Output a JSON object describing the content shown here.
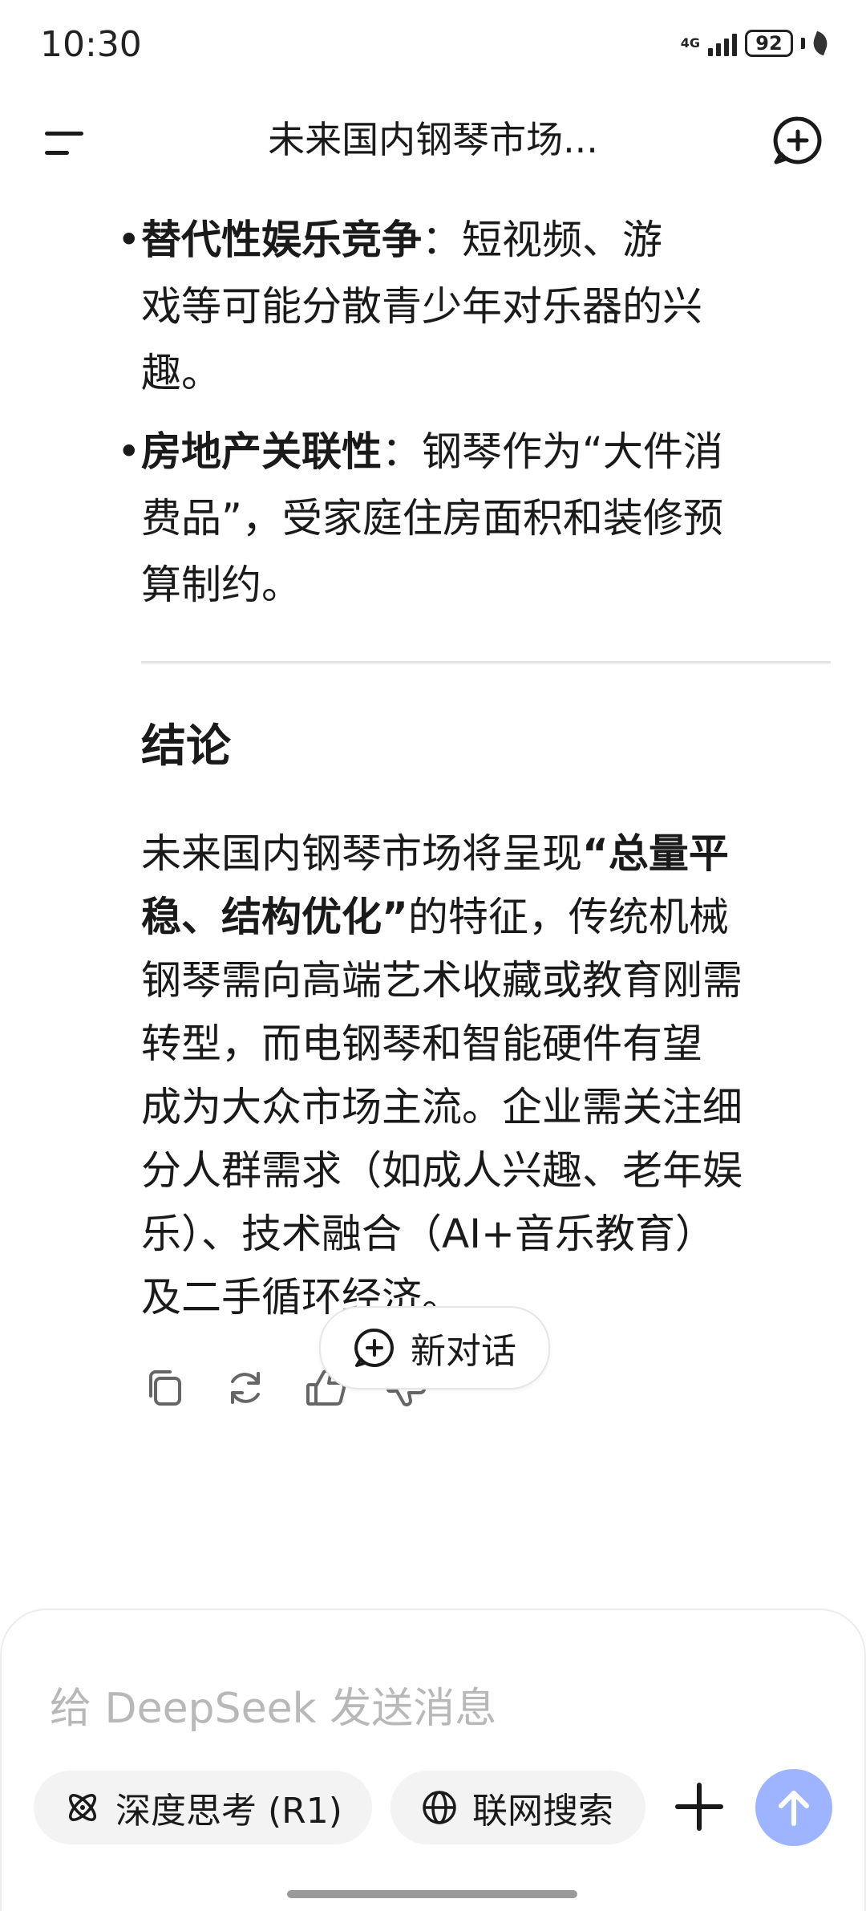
{
  "status_bar": {
    "time": "10:30",
    "network": "4G",
    "battery": "92"
  },
  "header": {
    "title": "未来国内钢琴市场...",
    "menu_icon": "menu-icon",
    "new_chat_icon": "chat-plus-icon"
  },
  "content": {
    "bullets": [
      {
        "term": "替代性娱乐竞争",
        "sep": "：",
        "text_line1": "短视频、游",
        "text_line2": "戏等可能分散青少年对乐器的兴",
        "text_line3": "趣。"
      },
      {
        "term": "房地产关联性",
        "sep": "：",
        "text_line1": "钢琴作为“大件消",
        "text_line2": "费品”，受家庭住房面积和装修预",
        "text_line3": "算制约。"
      }
    ],
    "conclusion_title": "结论",
    "conclusion": {
      "part1": "未来国内钢琴市场将呈现",
      "bold1": "“总量平",
      "bold2": "稳、结构优化”",
      "part2": "的特征，传统机械",
      "line3": "钢琴需向高端艺术收藏或教育刚需",
      "line4": "转型，而电钢琴和智能硬件有望",
      "line5": "成为大众市场主流。企业需关注细",
      "line6": "分人群需求（如成人兴趣、老年娱",
      "line7": "乐）、技术融合（AI+音乐教育）",
      "line8": "及二手循环经济。"
    }
  },
  "actions": {
    "copy_icon": "copy-icon",
    "regenerate_icon": "refresh-icon",
    "like_icon": "thumbs-up-icon",
    "dislike_icon": "thumbs-down-icon"
  },
  "new_dialog": {
    "label": "新对话"
  },
  "composer": {
    "placeholder": "给 DeepSeek 发送消息",
    "deep_think_label": "深度思考 (R1)",
    "web_search_label": "联网搜索",
    "accent_color": "#9fb4ff"
  }
}
